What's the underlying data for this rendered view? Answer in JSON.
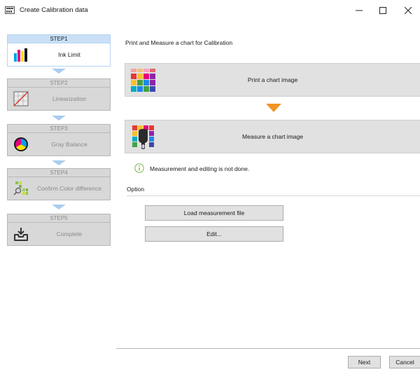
{
  "window": {
    "title": "Create Calibration data",
    "minimize_glyph": "–",
    "maximize_glyph": "☐",
    "close_glyph": "✕"
  },
  "steps": [
    {
      "header": "STEP1",
      "label": "Ink Limit",
      "icon": "ink-bars-icon",
      "state": "active"
    },
    {
      "header": "STEP2",
      "label": "Linearization",
      "icon": "linearization-graph-icon",
      "state": "disabled"
    },
    {
      "header": "STEP3",
      "label": "Gray Balance",
      "icon": "color-wheel-icon",
      "state": "disabled"
    },
    {
      "header": "STEP4",
      "label": "Confirm Color difference",
      "icon": "color-patch-magnifier-icon",
      "state": "disabled"
    },
    {
      "header": "STEP5",
      "label": "Complete",
      "icon": "inbox-tray-icon",
      "state": "disabled"
    }
  ],
  "main": {
    "heading": "Print and Measure a chart for Calibration",
    "print_button": "Print a chart image",
    "measure_button": "Measure a chart image",
    "status_text": "Measurement and editing is not done."
  },
  "option": {
    "title": "Option",
    "load_button": "Load measurement file",
    "edit_button": "Edit..."
  },
  "footer": {
    "next_button": "Next",
    "cancel_button": "Cancel"
  },
  "colors": {
    "active_step_header": "#c9e0f7",
    "disabled_step": "#d8d8d8",
    "step_arrow": "#a9ccef",
    "flow_arrow": "#f39322",
    "info_icon": "#7cb342"
  }
}
